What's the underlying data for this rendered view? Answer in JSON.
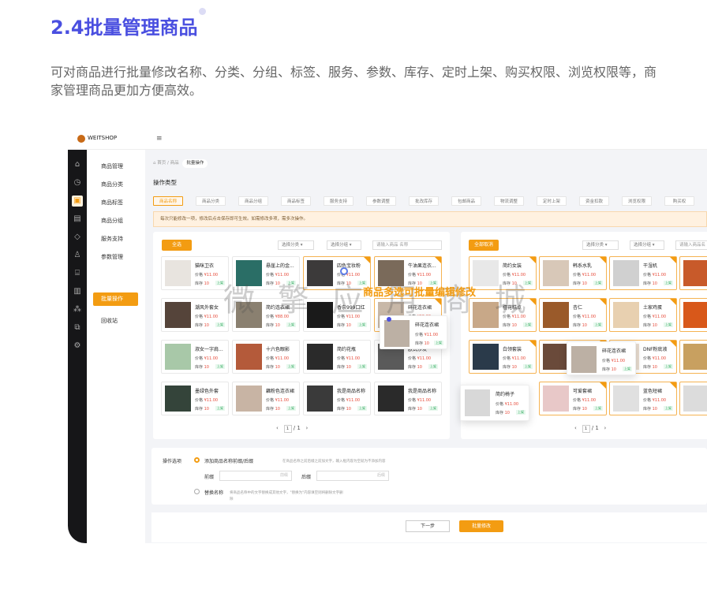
{
  "heading": {
    "title": "2.4批量管理商品",
    "desc": "可对商品进行批量修改名称、分类、分组、标签、服务、参数、库存、定时上架、购买权限、浏览权限等，商家管理商品更加方便高效。"
  },
  "app": {
    "brand": "WEITSHOP",
    "menu_icon": "≡",
    "side_icons": [
      "home-icon",
      "dashboard-icon",
      "goods-icon",
      "order-icon",
      "tag-icon",
      "user-icon",
      "shop-icon",
      "finance-icon",
      "app-icon",
      "plugin-icon",
      "settings-icon"
    ],
    "subnav": [
      "商品管理",
      "商品分类",
      "商品标签",
      "商品分组",
      "服务支持",
      "参数管理"
    ],
    "subnav_active": "批量操作",
    "subnav_bottom": "回收站",
    "crumb": [
      "首页",
      "商品"
    ],
    "crumb_active": "批量操作",
    "op_type_label": "操作类型",
    "tabs": [
      "商品名称",
      "商品分类",
      "商品分组",
      "商品标签",
      "服务支持",
      "参数调整",
      "批改库存",
      "包邮商品",
      "物流调整",
      "定时上架",
      "资金扣款",
      "浏览权限",
      "购买权"
    ],
    "notice": "每次只能修改一项，修改后点击保存即可生效。如需修改多项，需多次操作。",
    "left": {
      "select_all": "全选",
      "cat": "选择分类",
      "grp": "选择分组",
      "search": "请输入商品 名称",
      "page_cur": "1",
      "page_total": "/ 1"
    },
    "right": {
      "cancel_all": "全部取消",
      "cat": "选择分类",
      "grp": "选择分组",
      "search": "请输入商品名",
      "page_cur": "1",
      "page_total": "/ 1"
    },
    "price_label": "价格",
    "stock_label": "库存",
    "left_cards": [
      {
        "name": "猫咪卫衣",
        "price": "¥11.00",
        "stock": "10",
        "tag": "上架",
        "thumb": "#e8e4df"
      },
      {
        "name": "悬崖上的金...",
        "price": "¥11.00",
        "stock": "10",
        "tag": "上架",
        "thumb": "#2a6e66"
      },
      {
        "name": "四色宝妆粉",
        "price": "¥11.00",
        "stock": "10",
        "tag": "上架",
        "thumb": "#3c3a3a",
        "sel": true
      },
      {
        "name": "牛油果连衣...",
        "price": "¥11.00",
        "stock": "10",
        "tag": "上架",
        "thumb": "#7a6a5a",
        "sel": true
      },
      {
        "name": "潮风外套女",
        "price": "¥11.00",
        "stock": "10",
        "tag": "上架",
        "thumb": "#55443a"
      },
      {
        "name": "简约连衣裙",
        "price": "¥88.00",
        "stock": "10",
        "tag": "上架",
        "thumb": "#8a8070"
      },
      {
        "name": "香奈999口红",
        "price": "¥11.00",
        "stock": "10",
        "tag": "上架",
        "thumb": "#1a1a1a"
      },
      {
        "name": "碎花连衣裙",
        "price": "¥15.00",
        "stock": "10",
        "tag": "上架",
        "thumb": "#c8b8a8",
        "sel": true
      },
      {
        "name": "淑女一字肩...",
        "price": "¥11.00",
        "stock": "10",
        "tag": "上架",
        "thumb": "#a8c8a8"
      },
      {
        "name": "十六色眼影",
        "price": "¥11.00",
        "stock": "10",
        "tag": "上架",
        "thumb": "#b45a3a"
      },
      {
        "name": "简约花瓶",
        "price": "¥11.00",
        "stock": "10",
        "tag": "上架",
        "thumb": "#2a2a2a"
      },
      {
        "name": "欧式沙发",
        "price": "¥11.00",
        "stock": "10",
        "tag": "上架",
        "thumb": "#5a5a5a"
      },
      {
        "name": "墨绿色外套",
        "price": "¥11.00",
        "stock": "10",
        "tag": "上架",
        "thumb": "#34443a"
      },
      {
        "name": "藕粉色连衣裙",
        "price": "¥11.00",
        "stock": "10",
        "tag": "上架",
        "thumb": "#c8b4a4"
      },
      {
        "name": "我是商品名称",
        "price": "¥11.00",
        "stock": "10",
        "tag": "上架",
        "thumb": "#3a3a3a"
      },
      {
        "name": "我是商品名称",
        "price": "¥11.00",
        "stock": "10",
        "tag": "上架",
        "thumb": "#2a2a2a"
      }
    ],
    "right_cards": [
      {
        "name": "简约女装",
        "price": "¥11.00",
        "stock": "10",
        "tag": "上架",
        "thumb": "#e8e8e8"
      },
      {
        "name": "韩系水乳",
        "price": "¥11.00",
        "stock": "10",
        "tag": "上架",
        "thumb": "#d8c8b8"
      },
      {
        "name": "干湿机",
        "price": "¥11.00",
        "stock": "10",
        "tag": "上架",
        "thumb": "#d0d0d0"
      },
      {
        "name": "",
        "price": "",
        "stock": "",
        "tag": "",
        "thumb": "#c85a2a"
      },
      {
        "name": "檀花糕点",
        "price": "¥11.00",
        "stock": "10",
        "tag": "上架",
        "thumb": "#c8a888"
      },
      {
        "name": "杏仁",
        "price": "¥11.00",
        "stock": "10",
        "tag": "上架",
        "thumb": "#9a5a2a"
      },
      {
        "name": "土家鸡蛋",
        "price": "¥11.00",
        "stock": "10",
        "tag": "上架",
        "thumb": "#e8d0b0"
      },
      {
        "name": "",
        "price": "",
        "stock": "",
        "tag": "",
        "thumb": "#d8581a"
      },
      {
        "name": "白领套装",
        "price": "¥11.00",
        "stock": "10",
        "tag": "上架",
        "thumb": "#2a3a4a"
      },
      {
        "name": "",
        "price": "",
        "stock": "",
        "tag": "",
        "thumb": "#6a4a3a"
      },
      {
        "name": "DNF粉底液",
        "price": "¥11.00",
        "stock": "10",
        "tag": "上架",
        "thumb": "#e8dcd0"
      },
      {
        "name": "",
        "price": "",
        "stock": "",
        "tag": "",
        "thumb": "#c8a060"
      },
      {
        "name": "可爱套裙",
        "price": "¥11.00",
        "stock": "10",
        "tag": "上架",
        "thumb": "#e8c8c8"
      },
      {
        "name": "蓝色短裙",
        "price": "¥11.00",
        "stock": "10",
        "tag": "上架",
        "thumb": "#e0e0e0"
      },
      {
        "name": "",
        "price": "",
        "stock": "",
        "tag": "",
        "thumb": "#dcdcdc"
      }
    ],
    "floating": [
      {
        "name": "碎花连衣裙",
        "price": "¥11.00",
        "stock": "10",
        "tag": "上架",
        "thumb": "#bcb0a4"
      },
      {
        "name": "简约椅子",
        "price": "¥11.00",
        "stock": "10",
        "tag": "上架",
        "thumb": "#d8d8d8"
      }
    ],
    "form": {
      "label": "操作选项",
      "opt1": "添加商品名称前缀/后缀",
      "opt1_hint": "在商品名称之前后缀之前加文字，输入框内容为空就为不添加内容",
      "prefix": "前缀",
      "suffix": "后缀",
      "ph1": "前缀",
      "ph2": "后缀",
      "opt2": "替换名称",
      "opt2_hint": "将商品名称中的文字替换成其他文字，\"替换为\"内容填空则将删除文字删",
      "opt2_hint2": "除"
    },
    "footer": {
      "next": "下一步",
      "submit": "批量修改"
    },
    "overlay": {
      "watermark": "微 擎 应 用 商 城",
      "flow": "商品多选可批量编辑修改"
    }
  }
}
